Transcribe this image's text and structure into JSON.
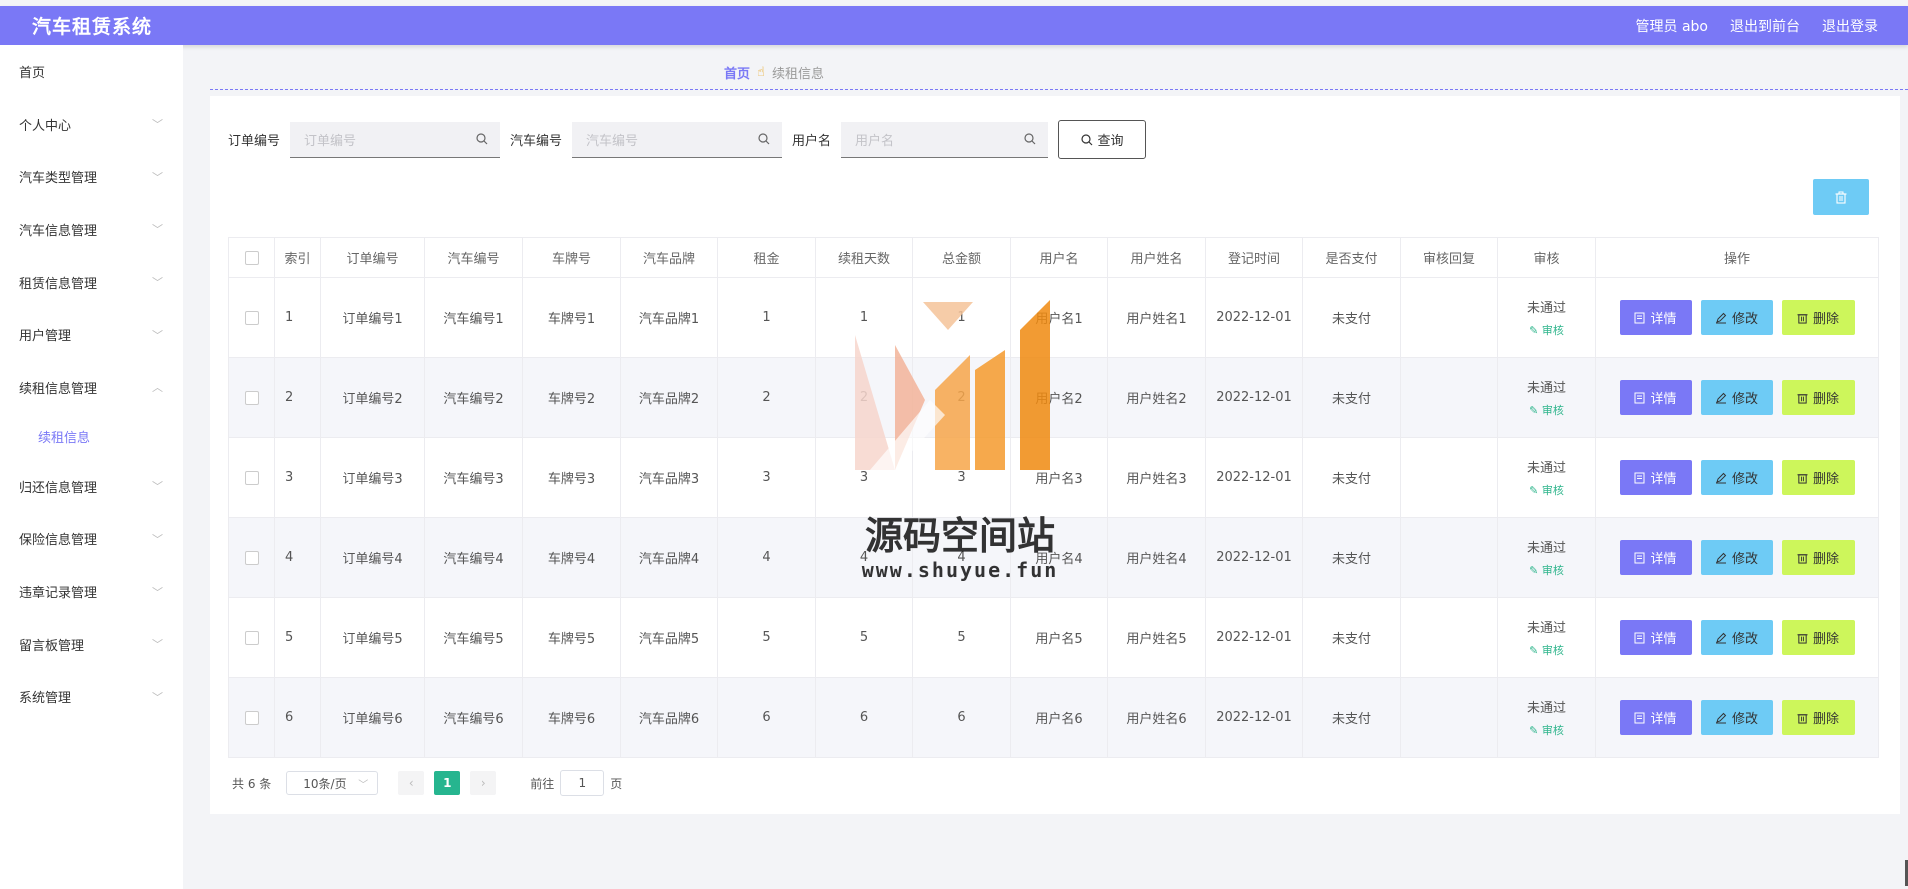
{
  "header": {
    "app_title": "汽车租赁系统",
    "admin_label": "管理员 abo",
    "front_label": "退出到前台",
    "logout_label": "退出登录"
  },
  "sidebar": {
    "items": [
      {
        "label": "首页",
        "expandable": false
      },
      {
        "label": "个人中心",
        "expandable": true
      },
      {
        "label": "汽车类型管理",
        "expandable": true
      },
      {
        "label": "汽车信息管理",
        "expandable": true
      },
      {
        "label": "租赁信息管理",
        "expandable": true
      },
      {
        "label": "用户管理",
        "expandable": true
      },
      {
        "label": "续租信息管理",
        "expandable": true,
        "expanded": true
      },
      {
        "label": "归还信息管理",
        "expandable": true
      },
      {
        "label": "保险信息管理",
        "expandable": true
      },
      {
        "label": "违章记录管理",
        "expandable": true
      },
      {
        "label": "留言板管理",
        "expandable": true
      },
      {
        "label": "系统管理",
        "expandable": true
      }
    ],
    "subitem": "续租信息"
  },
  "breadcrumb": {
    "home": "首页",
    "current": "续租信息"
  },
  "search": {
    "order_label": "订单编号",
    "order_placeholder": "订单编号",
    "car_label": "汽车编号",
    "car_placeholder": "汽车编号",
    "user_label": "用户名",
    "user_placeholder": "用户名",
    "query_label": "查询"
  },
  "table": {
    "headers": [
      "",
      "索引",
      "订单编号",
      "汽车编号",
      "车牌号",
      "汽车品牌",
      "租金",
      "续租天数",
      "总金额",
      "用户名",
      "用户姓名",
      "登记时间",
      "是否支付",
      "审核回复",
      "审核",
      "操作"
    ],
    "rows": [
      {
        "idx": "1",
        "order": "订单编号1",
        "car": "汽车编号1",
        "plate": "车牌号1",
        "brand": "汽车品牌1",
        "rent": "1",
        "days": "1",
        "total": "1",
        "user": "用户名1",
        "name": "用户姓名1",
        "time": "2022-12-01",
        "paid": "未支付",
        "reply": "",
        "status": "未通过",
        "audit": "审核"
      },
      {
        "idx": "2",
        "order": "订单编号2",
        "car": "汽车编号2",
        "plate": "车牌号2",
        "brand": "汽车品牌2",
        "rent": "2",
        "days": "2",
        "total": "2",
        "user": "用户名2",
        "name": "用户姓名2",
        "time": "2022-12-01",
        "paid": "未支付",
        "reply": "",
        "status": "未通过",
        "audit": "审核"
      },
      {
        "idx": "3",
        "order": "订单编号3",
        "car": "汽车编号3",
        "plate": "车牌号3",
        "brand": "汽车品牌3",
        "rent": "3",
        "days": "3",
        "total": "3",
        "user": "用户名3",
        "name": "用户姓名3",
        "time": "2022-12-01",
        "paid": "未支付",
        "reply": "",
        "status": "未通过",
        "audit": "审核"
      },
      {
        "idx": "4",
        "order": "订单编号4",
        "car": "汽车编号4",
        "plate": "车牌号4",
        "brand": "汽车品牌4",
        "rent": "4",
        "days": "4",
        "total": "4",
        "user": "用户名4",
        "name": "用户姓名4",
        "time": "2022-12-01",
        "paid": "未支付",
        "reply": "",
        "status": "未通过",
        "audit": "审核"
      },
      {
        "idx": "5",
        "order": "订单编号5",
        "car": "汽车编号5",
        "plate": "车牌号5",
        "brand": "汽车品牌5",
        "rent": "5",
        "days": "5",
        "total": "5",
        "user": "用户名5",
        "name": "用户姓名5",
        "time": "2022-12-01",
        "paid": "未支付",
        "reply": "",
        "status": "未通过",
        "audit": "审核"
      },
      {
        "idx": "6",
        "order": "订单编号6",
        "car": "汽车编号6",
        "plate": "车牌号6",
        "brand": "汽车品牌6",
        "rent": "6",
        "days": "6",
        "total": "6",
        "user": "用户名6",
        "name": "用户姓名6",
        "time": "2022-12-01",
        "paid": "未支付",
        "reply": "",
        "status": "未通过",
        "audit": "审核"
      }
    ],
    "actions": {
      "view": "详情",
      "edit": "修改",
      "delete": "删除"
    }
  },
  "pagination": {
    "total": "共 6 条",
    "page_size": "10条/页",
    "current_page": "1",
    "goto_prefix": "前往",
    "goto_value": "1",
    "goto_suffix": "页"
  },
  "watermark": {
    "title": "源码空间站",
    "url": "www.shuyue.fun"
  },
  "colors": {
    "brand": "#7a78f6",
    "view_button": "#7a78f6",
    "edit_button": "#6ecbf5",
    "delete_button": "#cdf65b",
    "active_page": "#26b58f",
    "audit_link": "#2fb58c"
  }
}
